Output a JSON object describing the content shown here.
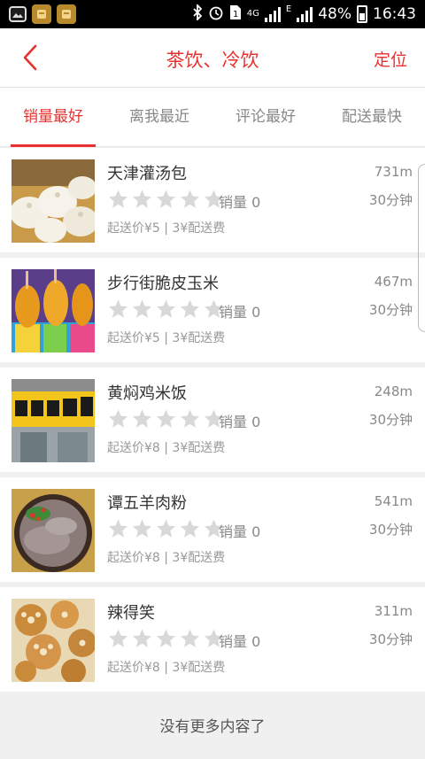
{
  "status": {
    "battery": "48%",
    "time": "16:43",
    "network": "4G",
    "network_sub": "E"
  },
  "nav": {
    "title": "茶饮、冷饮",
    "location_label": "定位"
  },
  "tabs": [
    {
      "label": "销量最好",
      "active": true
    },
    {
      "label": "离我最近",
      "active": false
    },
    {
      "label": "评论最好",
      "active": false
    },
    {
      "label": "配送最快",
      "active": false
    }
  ],
  "shops": [
    {
      "name": "天津灌汤包",
      "distance": "731m",
      "sales": "销量 0",
      "time": "30分钟",
      "fee": "起送价¥5 | 3¥配送费",
      "rating": 0,
      "image": "dumplings"
    },
    {
      "name": "步行街脆皮玉米",
      "distance": "467m",
      "sales": "销量 0",
      "time": "30分钟",
      "fee": "起送价¥5 | 3¥配送费",
      "rating": 0,
      "image": "corn"
    },
    {
      "name": "黄焖鸡米饭",
      "distance": "248m",
      "sales": "销量 0",
      "time": "30分钟",
      "fee": "起送价¥8 | 3¥配送费",
      "rating": 0,
      "image": "storefront"
    },
    {
      "name": "谭五羊肉粉",
      "distance": "541m",
      "sales": "销量 0",
      "time": "30分钟",
      "fee": "起送价¥8 | 3¥配送费",
      "rating": 0,
      "image": "noodles"
    },
    {
      "name": "辣得笑",
      "distance": "311m",
      "sales": "销量 0",
      "time": "30分钟",
      "fee": "起送价¥8 | 3¥配送费",
      "rating": 0,
      "image": "lotus"
    }
  ],
  "footer": {
    "text": "没有更多内容了"
  },
  "colors": {
    "accent": "#e8312f",
    "star_empty": "#d8d8d8"
  }
}
